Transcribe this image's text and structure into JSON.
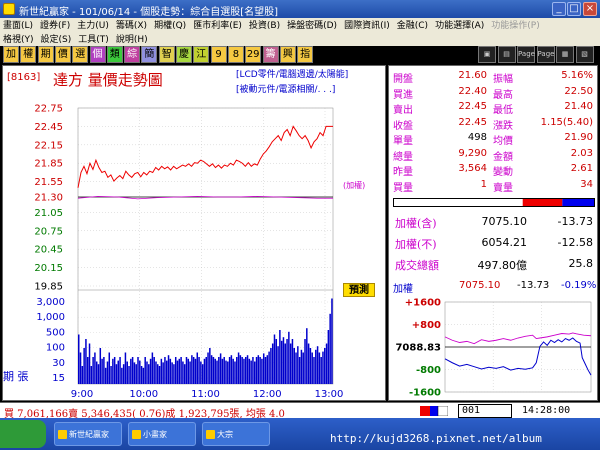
{
  "window": {
    "title": "新世紀贏家 - 101/06/14 - 個股走勢：綜合自選股[名望股]",
    "min_label": "_",
    "max_label": "□",
    "close_label": "×"
  },
  "menu": {
    "row1": [
      {
        "label": "畫面(L)",
        "disabled": false
      },
      {
        "label": "證券(F)",
        "disabled": false
      },
      {
        "label": "主力(U)",
        "disabled": false
      },
      {
        "label": "籌碼(X)",
        "disabled": false
      },
      {
        "label": "期權(Q)",
        "disabled": false
      },
      {
        "label": "匯市利率(E)",
        "disabled": false
      },
      {
        "label": "投資(B)",
        "disabled": false
      },
      {
        "label": "操盤密碼(D)",
        "disabled": false
      },
      {
        "label": "國際資訊(I)",
        "disabled": false
      },
      {
        "label": "金融(C)",
        "disabled": false
      },
      {
        "label": "功能選擇(A)",
        "disabled": false
      },
      {
        "label": "功能操作(P)",
        "disabled": true
      }
    ],
    "row2": [
      {
        "label": "格視(Y)",
        "disabled": false
      },
      {
        "label": "設定(S)",
        "disabled": false
      },
      {
        "label": "工具(T)",
        "disabled": false
      },
      {
        "label": "說明(H)",
        "disabled": false
      }
    ]
  },
  "toolbar": {
    "buttons": [
      {
        "label": "加",
        "bg": "#f5c842",
        "fg": "#000"
      },
      {
        "label": "權",
        "bg": "#f5c842",
        "fg": "#000"
      },
      {
        "label": "期",
        "bg": "#f5c842",
        "fg": "#000"
      },
      {
        "label": "價",
        "bg": "#f5c842",
        "fg": "#000"
      },
      {
        "label": "選",
        "bg": "#f5c842",
        "fg": "#000"
      },
      {
        "label": "個",
        "bg": "#b040c0",
        "fg": "#fff"
      },
      {
        "label": "類",
        "bg": "#3cc93c",
        "fg": "#000"
      },
      {
        "label": "綜",
        "bg": "#c040a0",
        "fg": "#fff"
      },
      {
        "label": "簡",
        "bg": "#9090e0",
        "fg": "#000"
      },
      {
        "label": "智",
        "bg": "#e0d050",
        "fg": "#000"
      },
      {
        "label": "慶",
        "bg": "#a8d840",
        "fg": "#000"
      },
      {
        "label": "江",
        "bg": "#c0d030",
        "fg": "#000"
      },
      {
        "label": "9",
        "bg": "#f5c842",
        "fg": "#000"
      },
      {
        "label": "8",
        "bg": "#f5c842",
        "fg": "#000"
      },
      {
        "label": "29",
        "bg": "#f5c842",
        "fg": "#000"
      },
      {
        "label": "籌",
        "bg": "#c06090",
        "fg": "#fff"
      },
      {
        "label": "興",
        "bg": "#f5c842",
        "fg": "#000"
      },
      {
        "label": "指",
        "bg": "#f5c842",
        "fg": "#000"
      }
    ],
    "right_buttons": [
      "▣",
      "▤",
      "Page",
      "Page",
      "▦",
      "▧"
    ]
  },
  "stock": {
    "code": "[8163]",
    "name_title": "達方  量價走勢圖",
    "tags_line1": "[LCD零件/電腦週邊/太陽能]",
    "tags_line2": "[被動元件/電源相關/. . .]",
    "hint": "(加權)",
    "sub_badge": "預測",
    "vol_unit": "期  張"
  },
  "quotes": [
    {
      "l1": "開盤",
      "v1": "21.60",
      "c1": "#c00",
      "l2": "振幅",
      "v2": "5.16%",
      "c2": "#c00"
    },
    {
      "l1": "買進",
      "v1": "22.40",
      "c1": "#c00",
      "l2": "最高",
      "v2": "22.50",
      "c2": "#c00"
    },
    {
      "l1": "賣出",
      "v1": "22.45",
      "c1": "#c00",
      "l2": "最低",
      "v2": "21.40",
      "c2": "#c00"
    },
    {
      "l1": "收盤",
      "v1": "22.45",
      "c1": "#c00",
      "l2": "漲跌",
      "v2": "1.15(5.40)",
      "c2": "#c00"
    },
    {
      "l1": "單量",
      "v1": "498",
      "c1": "#000",
      "l2": "均價",
      "v2": "21.90",
      "c2": "#c00"
    },
    {
      "l1": "總量",
      "v1": "9,290",
      "c1": "#c00",
      "l2": "金額",
      "v2": "2.03",
      "c2": "#c00"
    },
    {
      "l1": "昨量",
      "v1": "3,564",
      "c1": "#c00",
      "l2": "變動",
      "v2": "2.61",
      "c2": "#c00"
    },
    {
      "l1": "買量",
      "v1": "1",
      "c1": "#c00",
      "l2": "賣量",
      "v2": "34",
      "c2": "#c00"
    }
  ],
  "indices": [
    {
      "label": "加權(含)",
      "value": "7075.10",
      "change": "-13.73"
    },
    {
      "label": "加權(不)",
      "value": "6054.21",
      "change": "-12.58"
    },
    {
      "label": "成交總額",
      "value": "497.80億",
      "change": "25.8"
    }
  ],
  "mini": {
    "label": "加權",
    "value": "7075.10",
    "change": "-13.73",
    "pct": "-0.19%",
    "ticks": [
      "+1600",
      "+800",
      "7088.83",
      "-800",
      "-1600"
    ]
  },
  "status": {
    "text": "買 7,061,166賣 5,346,435( 0.76)成 1,923,795張, 均張 4.0",
    "code": "001",
    "time": "14:28:00"
  },
  "taskbar": {
    "items": [
      "新世紀贏家",
      "小畫家",
      "大宗"
    ],
    "url": "http://kujd3268.pixnet.net/album"
  },
  "chart_data": {
    "type": "line",
    "x": [
      "9:00",
      "10:00",
      "11:00",
      "12:00",
      "13:00"
    ],
    "price_ticks": [
      "22.75",
      "22.45",
      "22.15",
      "21.85",
      "21.55",
      "21.30",
      "21.05",
      "20.75",
      "20.45",
      "20.15",
      "19.85"
    ],
    "ylim": [
      19.85,
      22.75
    ],
    "reference_price": 21.3,
    "volume_ticks": [
      "3,000",
      "1,000",
      "500",
      "100",
      "30",
      "15"
    ],
    "price_series": [
      [
        0,
        21.45
      ],
      [
        3,
        21.7
      ],
      [
        6,
        21.8
      ],
      [
        9,
        21.68
      ],
      [
        12,
        21.85
      ],
      [
        15,
        21.75
      ],
      [
        18,
        21.9
      ],
      [
        21,
        21.78
      ],
      [
        24,
        21.7
      ],
      [
        27,
        21.72
      ],
      [
        30,
        21.62
      ],
      [
        33,
        21.66
      ],
      [
        36,
        21.56
      ],
      [
        39,
        21.61
      ],
      [
        42,
        21.65
      ],
      [
        45,
        21.6
      ],
      [
        48,
        21.72
      ],
      [
        51,
        21.66
      ],
      [
        54,
        21.62
      ],
      [
        57,
        21.68
      ],
      [
        60,
        21.7
      ],
      [
        63,
        21.63
      ],
      [
        66,
        21.7
      ],
      [
        69,
        21.66
      ],
      [
        72,
        21.72
      ],
      [
        75,
        21.7
      ],
      [
        78,
        21.78
      ],
      [
        81,
        21.74
      ],
      [
        84,
        21.8
      ],
      [
        87,
        21.76
      ],
      [
        90,
        21.79
      ],
      [
        93,
        21.74
      ],
      [
        96,
        21.8
      ],
      [
        99,
        21.76
      ],
      [
        102,
        21.79
      ],
      [
        105,
        21.82
      ],
      [
        108,
        21.8
      ],
      [
        111,
        21.84
      ],
      [
        114,
        21.8
      ],
      [
        117,
        21.86
      ],
      [
        120,
        21.85
      ],
      [
        123,
        21.9
      ],
      [
        126,
        21.88
      ],
      [
        129,
        21.84
      ],
      [
        132,
        21.8
      ],
      [
        135,
        21.84
      ],
      [
        138,
        21.78
      ],
      [
        141,
        21.82
      ],
      [
        144,
        21.77
      ],
      [
        147,
        21.82
      ],
      [
        150,
        21.8
      ],
      [
        153,
        21.85
      ],
      [
        156,
        21.82
      ],
      [
        159,
        21.9
      ],
      [
        162,
        21.88
      ],
      [
        165,
        21.85
      ],
      [
        168,
        21.8
      ],
      [
        171,
        21.86
      ],
      [
        174,
        21.8
      ],
      [
        177,
        21.84
      ],
      [
        180,
        21.82
      ],
      [
        183,
        21.92
      ],
      [
        186,
        22.0
      ],
      [
        189,
        22.05
      ],
      [
        192,
        22.12
      ],
      [
        195,
        22.2
      ],
      [
        198,
        22.25
      ],
      [
        201,
        22.3
      ],
      [
        204,
        22.22
      ],
      [
        207,
        22.35
      ],
      [
        210,
        22.4
      ],
      [
        213,
        22.3
      ],
      [
        216,
        22.45
      ],
      [
        219,
        22.38
      ],
      [
        222,
        22.3
      ],
      [
        225,
        22.25
      ],
      [
        228,
        22.3
      ],
      [
        231,
        22.22
      ],
      [
        234,
        22.1
      ],
      [
        237,
        22.2
      ],
      [
        240,
        22.25
      ],
      [
        243,
        22.35
      ],
      [
        246,
        22.3
      ],
      [
        249,
        22.45
      ],
      [
        252,
        22.45
      ],
      [
        256,
        22.45
      ]
    ],
    "avg_series": [
      [
        0,
        21.45
      ],
      [
        30,
        21.58
      ],
      [
        60,
        21.62
      ],
      [
        90,
        21.66
      ],
      [
        120,
        21.7
      ],
      [
        150,
        21.72
      ],
      [
        180,
        21.74
      ],
      [
        210,
        21.8
      ],
      [
        240,
        21.86
      ],
      [
        256,
        21.9
      ]
    ],
    "index_series": [
      [
        0,
        21.28
      ],
      [
        20,
        21.31
      ],
      [
        40,
        21.3
      ],
      [
        60,
        21.27
      ],
      [
        80,
        21.29
      ],
      [
        100,
        21.3
      ],
      [
        120,
        21.31
      ],
      [
        140,
        21.3
      ],
      [
        160,
        21.3
      ],
      [
        180,
        21.31
      ],
      [
        200,
        21.3
      ],
      [
        220,
        21.29
      ],
      [
        240,
        21.28
      ],
      [
        256,
        21.28
      ]
    ],
    "volume_series": [
      0.55,
      0.35,
      0.2,
      0.4,
      0.5,
      0.3,
      0.45,
      0.2,
      0.3,
      0.35,
      0.25,
      0.22,
      0.4,
      0.28,
      0.3,
      0.18,
      0.25,
      0.35,
      0.2,
      0.28,
      0.3,
      0.22,
      0.26,
      0.3,
      0.18,
      0.22,
      0.35,
      0.25,
      0.2,
      0.28,
      0.3,
      0.24,
      0.22,
      0.3,
      0.26,
      0.2,
      0.18,
      0.3,
      0.25,
      0.22,
      0.28,
      0.35,
      0.3,
      0.25,
      0.22,
      0.2,
      0.28,
      0.24,
      0.3,
      0.26,
      0.32,
      0.28,
      0.24,
      0.22,
      0.3,
      0.26,
      0.28,
      0.3,
      0.25,
      0.22,
      0.3,
      0.28,
      0.25,
      0.32,
      0.3,
      0.28,
      0.35,
      0.3,
      0.25,
      0.22,
      0.28,
      0.3,
      0.35,
      0.4,
      0.32,
      0.3,
      0.28,
      0.26,
      0.3,
      0.34,
      0.28,
      0.3,
      0.26,
      0.25,
      0.3,
      0.32,
      0.28,
      0.25,
      0.3,
      0.35,
      0.32,
      0.3,
      0.28,
      0.3,
      0.32,
      0.28,
      0.26,
      0.3,
      0.25,
      0.3,
      0.32,
      0.3,
      0.28,
      0.34,
      0.3,
      0.32,
      0.36,
      0.4,
      0.45,
      0.55,
      0.5,
      0.42,
      0.6,
      0.48,
      0.52,
      0.45,
      0.5,
      0.58,
      0.45,
      0.5,
      0.4,
      0.35,
      0.42,
      0.3,
      0.38,
      0.35,
      0.5,
      0.62,
      0.45,
      0.4,
      0.35,
      0.3,
      0.38,
      0.42,
      0.35,
      0.3,
      0.36,
      0.4,
      0.45,
      0.6,
      0.78,
      0.95
    ]
  },
  "mini_chart_data": {
    "type": "line",
    "ylim": [
      -1600,
      1600
    ],
    "index_series": [
      [
        0,
        -420
      ],
      [
        10,
        -560
      ],
      [
        20,
        -680
      ],
      [
        30,
        -620
      ],
      [
        40,
        -700
      ],
      [
        50,
        -780
      ],
      [
        60,
        -720
      ],
      [
        70,
        -760
      ],
      [
        80,
        -700
      ],
      [
        90,
        -820
      ],
      [
        100,
        -760
      ],
      [
        110,
        -790
      ],
      [
        120,
        -740
      ],
      [
        125,
        -560
      ],
      [
        130,
        20
      ],
      [
        135,
        180
      ],
      [
        140,
        60
      ],
      [
        145,
        240
      ],
      [
        150,
        160
      ],
      [
        155,
        260
      ],
      [
        160,
        180
      ],
      [
        165,
        300
      ],
      [
        170,
        240
      ],
      [
        175,
        320
      ],
      [
        180,
        200
      ],
      [
        185,
        140
      ],
      [
        188,
        -380
      ],
      [
        192,
        -600
      ],
      [
        196,
        -820
      ],
      [
        200,
        -1000
      ]
    ],
    "money_series": [
      [
        0,
        360
      ],
      [
        10,
        240
      ],
      [
        20,
        160
      ],
      [
        30,
        200
      ],
      [
        40,
        120
      ],
      [
        50,
        260
      ],
      [
        60,
        200
      ],
      [
        70,
        240
      ],
      [
        80,
        300
      ],
      [
        90,
        240
      ],
      [
        100,
        320
      ],
      [
        110,
        380
      ],
      [
        120,
        420
      ],
      [
        125,
        300
      ],
      [
        130,
        320
      ],
      [
        140,
        360
      ],
      [
        150,
        420
      ],
      [
        160,
        480
      ],
      [
        170,
        460
      ],
      [
        175,
        500
      ],
      [
        180,
        470
      ],
      [
        190,
        420
      ],
      [
        200,
        400
      ]
    ]
  }
}
